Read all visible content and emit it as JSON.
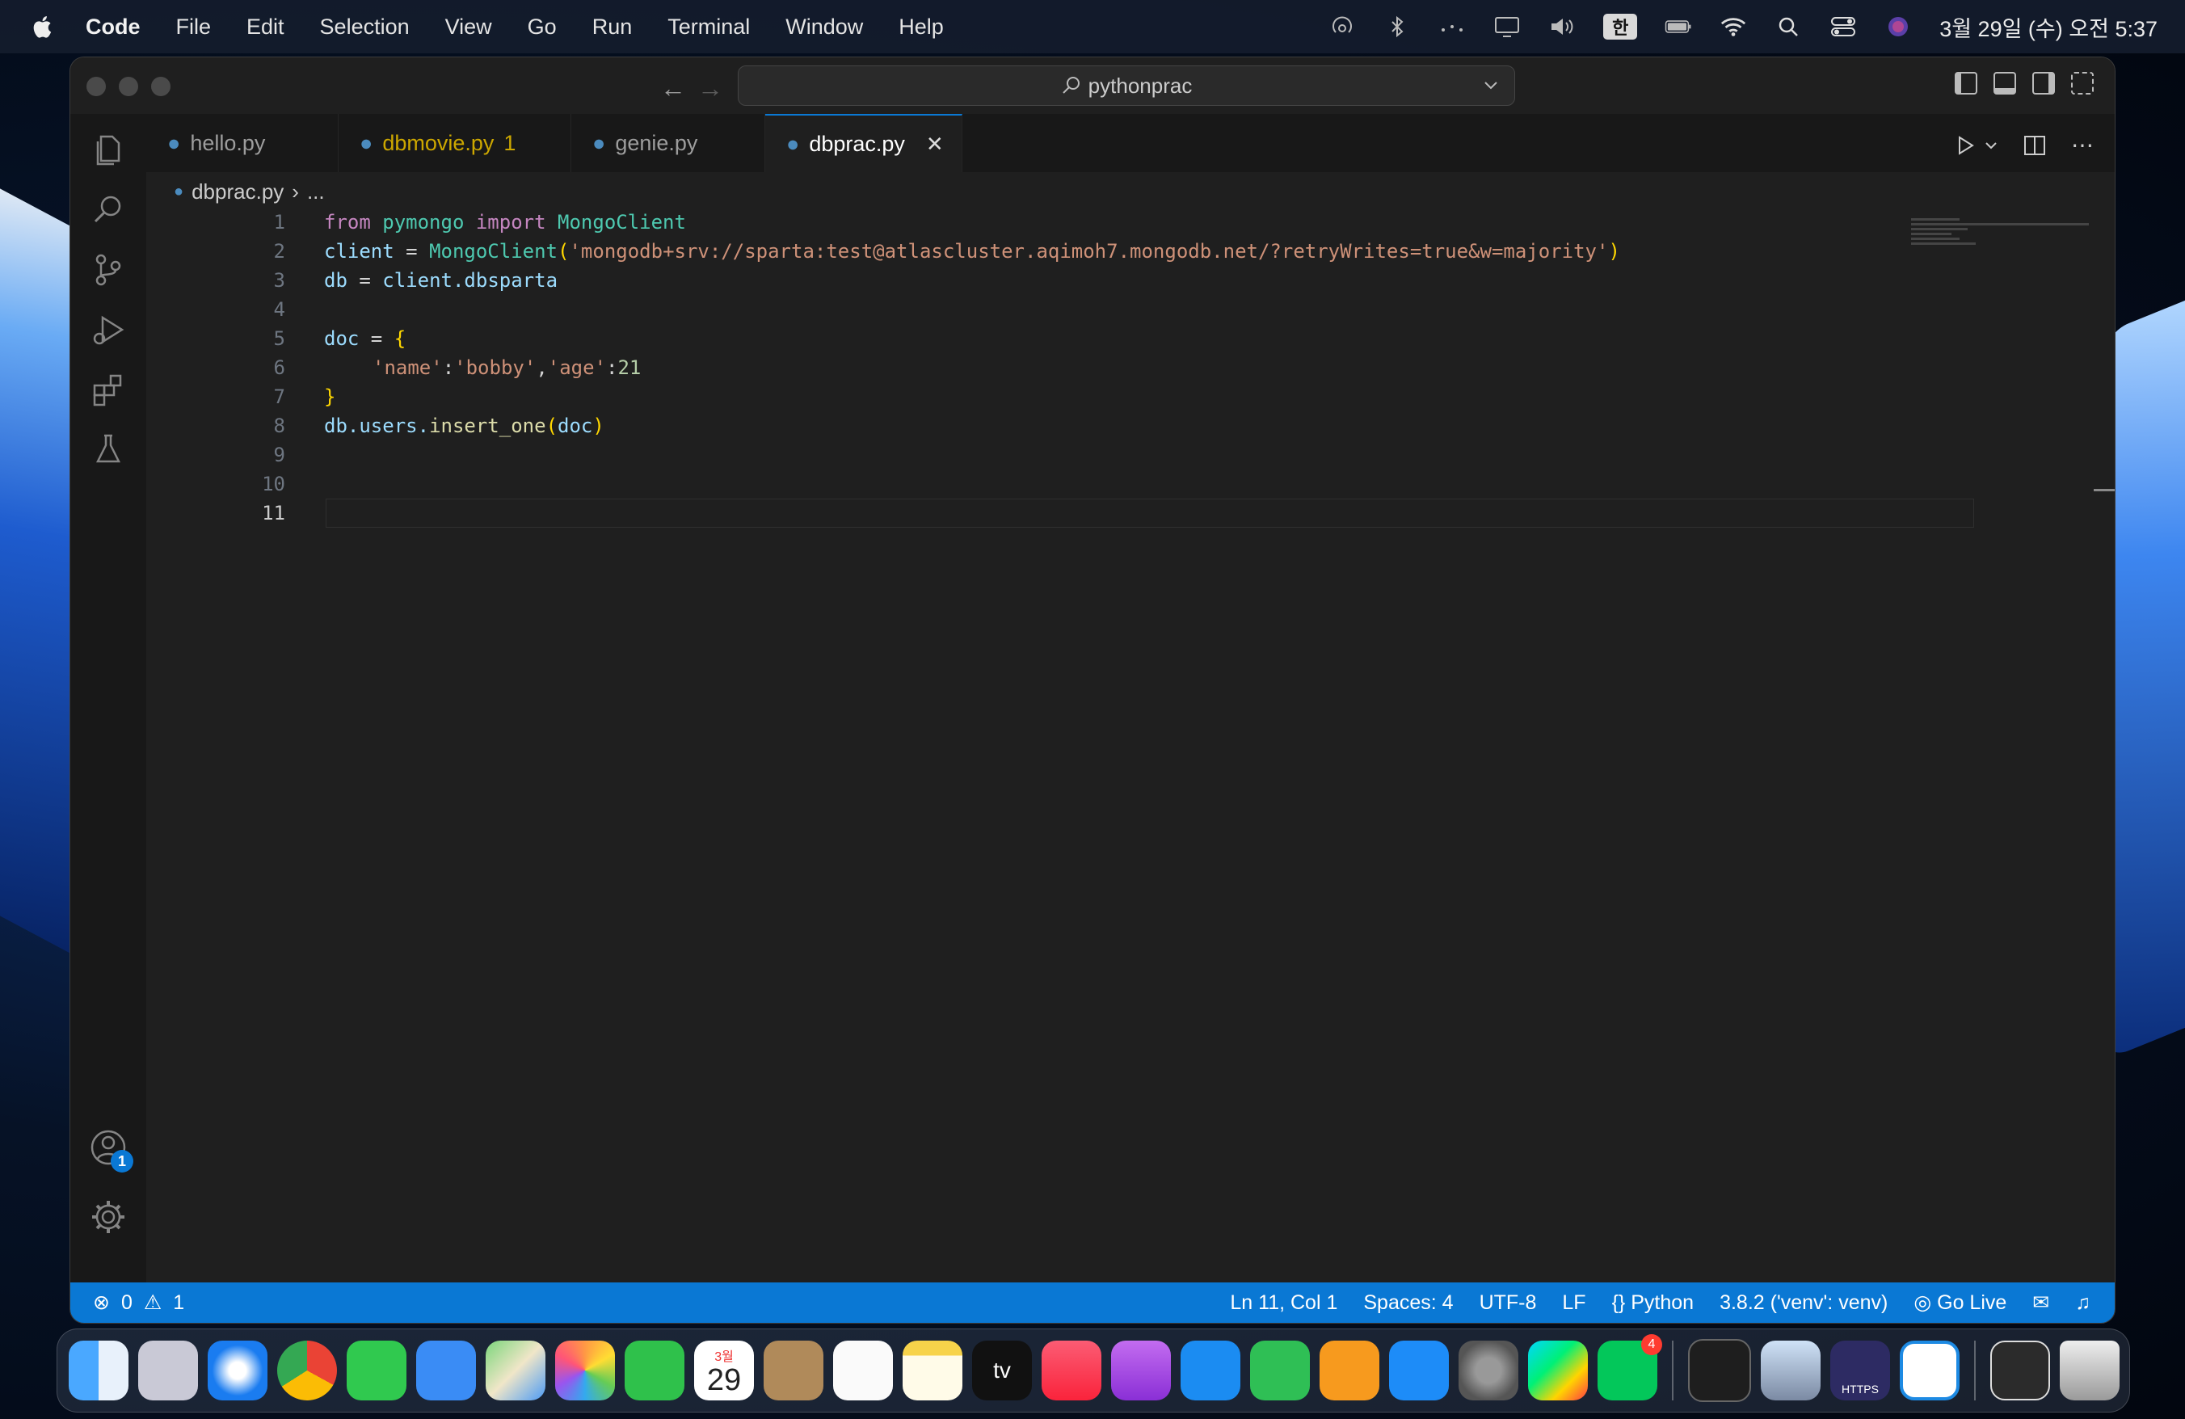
{
  "menubar": {
    "app_name": "Code",
    "items": [
      "File",
      "Edit",
      "Selection",
      "View",
      "Go",
      "Run",
      "Terminal",
      "Window",
      "Help"
    ],
    "input_method": "한",
    "clock": "3월 29일 (수) 오전 5:37"
  },
  "titlebar": {
    "search": "pythonprac"
  },
  "tabs": [
    {
      "label": "hello.py",
      "problems": ""
    },
    {
      "label": "dbmovie.py",
      "problems": "1"
    },
    {
      "label": "genie.py",
      "problems": ""
    },
    {
      "label": "dbprac.py",
      "problems": ""
    }
  ],
  "breadcrumb": {
    "file": "dbprac.py",
    "more": "..."
  },
  "editor": {
    "line_numbers": [
      "1",
      "2",
      "3",
      "4",
      "5",
      "6",
      "7",
      "8",
      "9",
      "10",
      "11"
    ],
    "current_line": "11"
  },
  "code": {
    "l1": {
      "from": "from",
      "module": "pymongo",
      "import": "import",
      "cls": "MongoClient"
    },
    "l2": {
      "var": "client",
      "eq": " = ",
      "cls": "MongoClient",
      "open": "(",
      "str": "'mongodb+srv://sparta:test@atlascluster.aqimoh7.mongodb.net/?retryWrites=true&w=majority'",
      "close": ")"
    },
    "l3": {
      "var": "db",
      "eq": " = ",
      "obj": "client",
      "attr": ".dbsparta"
    },
    "l5": {
      "var": "doc",
      "eq": " = ",
      "open": "{"
    },
    "l6": {
      "k1": "'name'",
      "c1": ":",
      "v1": "'bobby'",
      "sep": ",",
      "k2": "'age'",
      "c2": ":",
      "v2": "21"
    },
    "l7": {
      "close": "}"
    },
    "l8": {
      "obj": "db",
      "attr": ".users.",
      "fn": "insert_one",
      "open": "(",
      "arg": "doc",
      "close": ")"
    }
  },
  "activity_badge": "1",
  "statusbar": {
    "errors": "0",
    "warnings": "1",
    "position": "Ln 11, Col 1",
    "spaces": "Spaces: 4",
    "encoding": "UTF-8",
    "eol": "LF",
    "language": "Python",
    "interpreter": "3.8.2 ('venv': venv)",
    "golive": "Go Live"
  },
  "dock": {
    "calendar_month": "3월",
    "calendar_day": "29",
    "tv_label": "tv",
    "naver_badge": "4",
    "https_label": "HTTPS"
  },
  "colors": {
    "accent": "#0a78d4",
    "editor_bg": "#1f1f1f",
    "warning": "#cca700"
  }
}
